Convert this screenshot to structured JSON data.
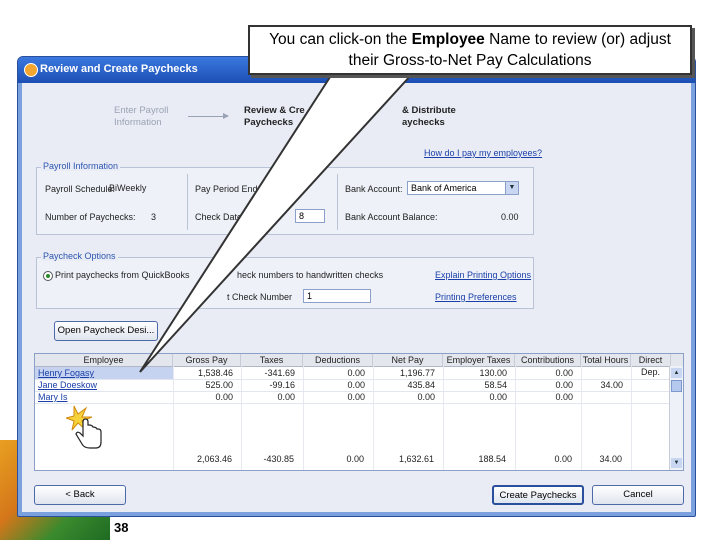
{
  "callout": {
    "before": "You can click-on the ",
    "bold": "Employee",
    "after": " Name to review (or) adjust their Gross-to-Net Pay Calculations"
  },
  "window": {
    "title": "Review and Create Paychecks"
  },
  "steps": {
    "step1_line1": "Enter Payroll",
    "step1_line2": "Information",
    "step2_line1": "Review & Cre",
    "step2_line2": "Paychecks",
    "step3_line1": "& Distribute",
    "step3_line2": "aychecks"
  },
  "help_link": "How do I pay my employees?",
  "payroll_info": {
    "group_label": "Payroll Information",
    "schedule_label": "Payroll Schedule:",
    "schedule_value": "BiWeekly",
    "num_paychecks_label": "Number of Paychecks:",
    "num_paychecks_value": "3",
    "pay_period_label": "Pay Period Ends",
    "check_date_label": "Check Date",
    "check_date_value": "8",
    "bank_account_label": "Bank Account:",
    "bank_account_value": "Bank of America",
    "bank_balance_label": "Bank Account Balance:",
    "bank_balance_value": "0.00"
  },
  "paycheck_options": {
    "group_label": "Paycheck Options",
    "print_option": "Print paychecks from QuickBooks",
    "handwritten_option": "heck numbers to handwritten checks",
    "check_number_label": "t Check Number",
    "check_number_value": "1",
    "explain_link": "Explain Printing Options",
    "preferences_link": "Printing Preferences"
  },
  "open_design_button": "Open Paycheck Desi...",
  "table": {
    "headers": [
      "Employee",
      "Gross Pay",
      "Taxes",
      "Deductions",
      "Net Pay",
      "Employer Taxes",
      "Contributions",
      "Total Hours",
      "Direct Dep."
    ],
    "rows": [
      [
        "Henry Fogasy",
        "1,538.46",
        "-341.69",
        "0.00",
        "1,196.77",
        "130.00",
        "0.00",
        "",
        ""
      ],
      [
        "Jane Doeskow",
        "525.00",
        "-99.16",
        "0.00",
        "435.84",
        "58.54",
        "0.00",
        "34.00",
        ""
      ],
      [
        "Mary Is",
        "0.00",
        "0.00",
        "0.00",
        "0.00",
        "0.00",
        "0.00",
        "",
        ""
      ]
    ],
    "totals": [
      "",
      "2,063.46",
      "-430.85",
      "0.00",
      "1,632.61",
      "188.54",
      "0.00",
      "34.00",
      ""
    ]
  },
  "buttons": {
    "back": "< Back",
    "create": "Create Paychecks",
    "cancel": "Cancel"
  },
  "slide_number": "38",
  "icons": {
    "app_icon": "quickbooks-icon",
    "cursor": "hand-pointer-icon"
  }
}
